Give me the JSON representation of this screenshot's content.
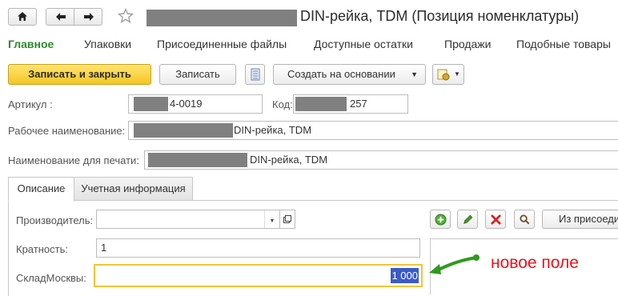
{
  "window": {
    "title": "DIN-рейка, TDM (Позиция номенклатуры)"
  },
  "nav": {
    "home_icon": "home-icon",
    "back_icon": "arrow-left-icon",
    "forward_icon": "arrow-right-icon",
    "favorite_icon": "star-outline-icon"
  },
  "section_tabs": [
    {
      "label": "Главное",
      "active": true
    },
    {
      "label": "Упаковки"
    },
    {
      "label": "Присоединенные файлы"
    },
    {
      "label": "Доступные остатки"
    },
    {
      "label": "Продажи"
    },
    {
      "label": "Подобные товары"
    }
  ],
  "toolbar": {
    "save_close_label": "Записать и закрыть",
    "save_label": "Записать",
    "create_based_label": "Создать на основании"
  },
  "form": {
    "article_label": "Артикул :",
    "article_value": "4-0019",
    "code_label": "Код:",
    "code_value": "257",
    "work_name_label": "Рабочее наименование:",
    "work_name_value": "DIN-рейка, TDM",
    "print_name_label": "Наименование для печати:",
    "print_name_value": "DIN-рейка, TDM"
  },
  "inner_tabs": [
    {
      "label": "Описание",
      "active": true
    },
    {
      "label": "Учетная информация"
    }
  ],
  "description": {
    "manufacturer_label": "Производитель:",
    "manufacturer_value": "",
    "multiplicity_label": "Кратность:",
    "multiplicity_value": "1",
    "warehouse_label": "СкладМосквы:",
    "warehouse_value": "1 000",
    "attach_button_label": "Из присоеди"
  },
  "annotation": {
    "text": "новое поле",
    "color": "#e8141c",
    "arrow_color": "#2e9a1e"
  },
  "colors": {
    "accent_green": "#2d8a2d",
    "primary_button": "#f4c625",
    "highlight_border": "#f0c43b"
  }
}
